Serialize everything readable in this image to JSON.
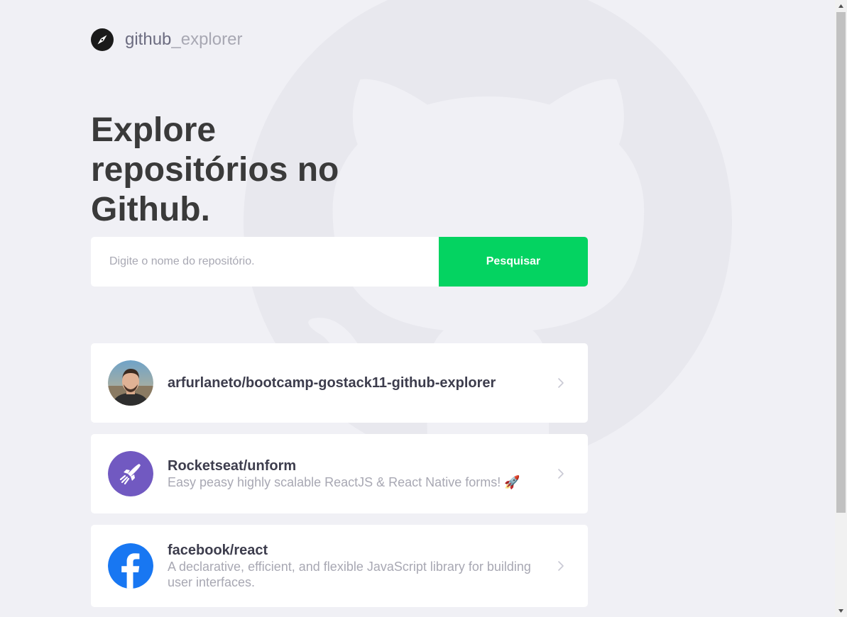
{
  "header": {
    "logo_icon": "compass-icon",
    "logo_text_strong": "github",
    "logo_text_light": "_explorer"
  },
  "main": {
    "title": "Explore repositórios no Github."
  },
  "search": {
    "placeholder": "Digite o nome do repositório.",
    "value": "",
    "button_label": "Pesquisar"
  },
  "repositories": [
    {
      "full_name": "arfurlaneto/bootcamp-gostack11-github-explorer",
      "description": "",
      "avatar": "user-photo-avatar"
    },
    {
      "full_name": "Rocketseat/unform",
      "description": "Easy peasy highly scalable ReactJS & React Native forms! 🚀",
      "avatar": "rocketseat-logo-avatar"
    },
    {
      "full_name": "facebook/react",
      "description": "A declarative, efficient, and flexible JavaScript library for building user interfaces.",
      "avatar": "facebook-logo-avatar"
    }
  ],
  "colors": {
    "background": "#f0f0f5",
    "accent_green": "#04d361",
    "title_text": "#3a3a3a",
    "muted_text": "#a8a8b3",
    "rocketseat_purple": "#7159c1",
    "facebook_blue": "#1877f2"
  }
}
